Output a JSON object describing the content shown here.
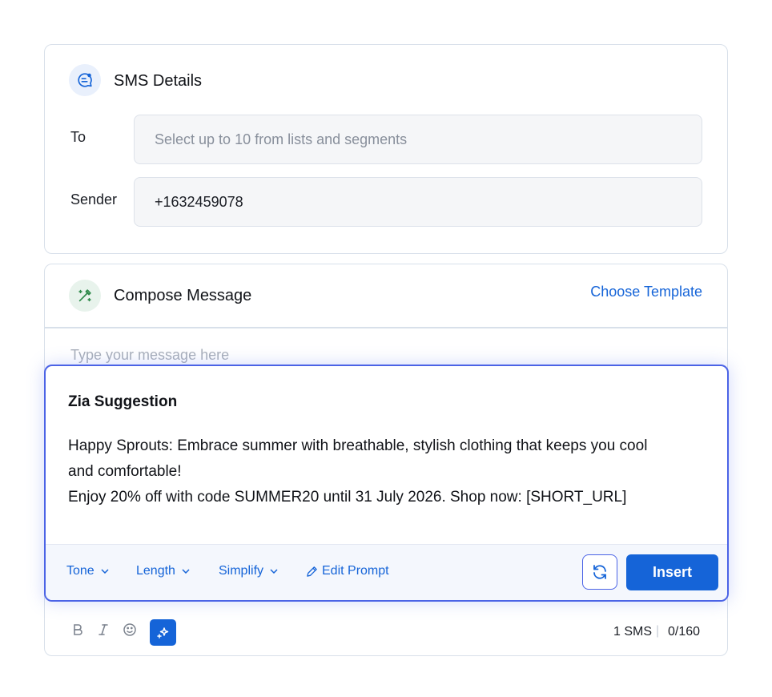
{
  "sms_details": {
    "title": "SMS Details",
    "to_label": "To",
    "to_placeholder": "Select up to 10 from lists and segments",
    "sender_label": "Sender",
    "sender_value": "+1632459078"
  },
  "compose": {
    "title": "Compose Message",
    "choose_template": "Choose Template",
    "message_placeholder": "Type your message here",
    "sms_count": "1 SMS",
    "char_count": "0/160",
    "format_buttons": [
      "bold-icon",
      "italic-icon",
      "emoji-icon",
      "zia-sparkle-icon"
    ]
  },
  "zia": {
    "title": "Zia Suggestion",
    "line1": "Happy Sprouts: Embrace summer with breathable, stylish clothing that keeps you cool and comfortable!",
    "line2": "Enjoy 20% off with code SUMMER20 until 31 July 2026. Shop now: [SHORT_URL]",
    "tone": "Tone",
    "length": "Length",
    "simplify": "Simplify",
    "edit_prompt": "Edit Prompt",
    "insert": "Insert"
  },
  "colors": {
    "accent": "#1564d8",
    "zia_border": "#4b63e6",
    "card_border": "#d8e0ea"
  }
}
